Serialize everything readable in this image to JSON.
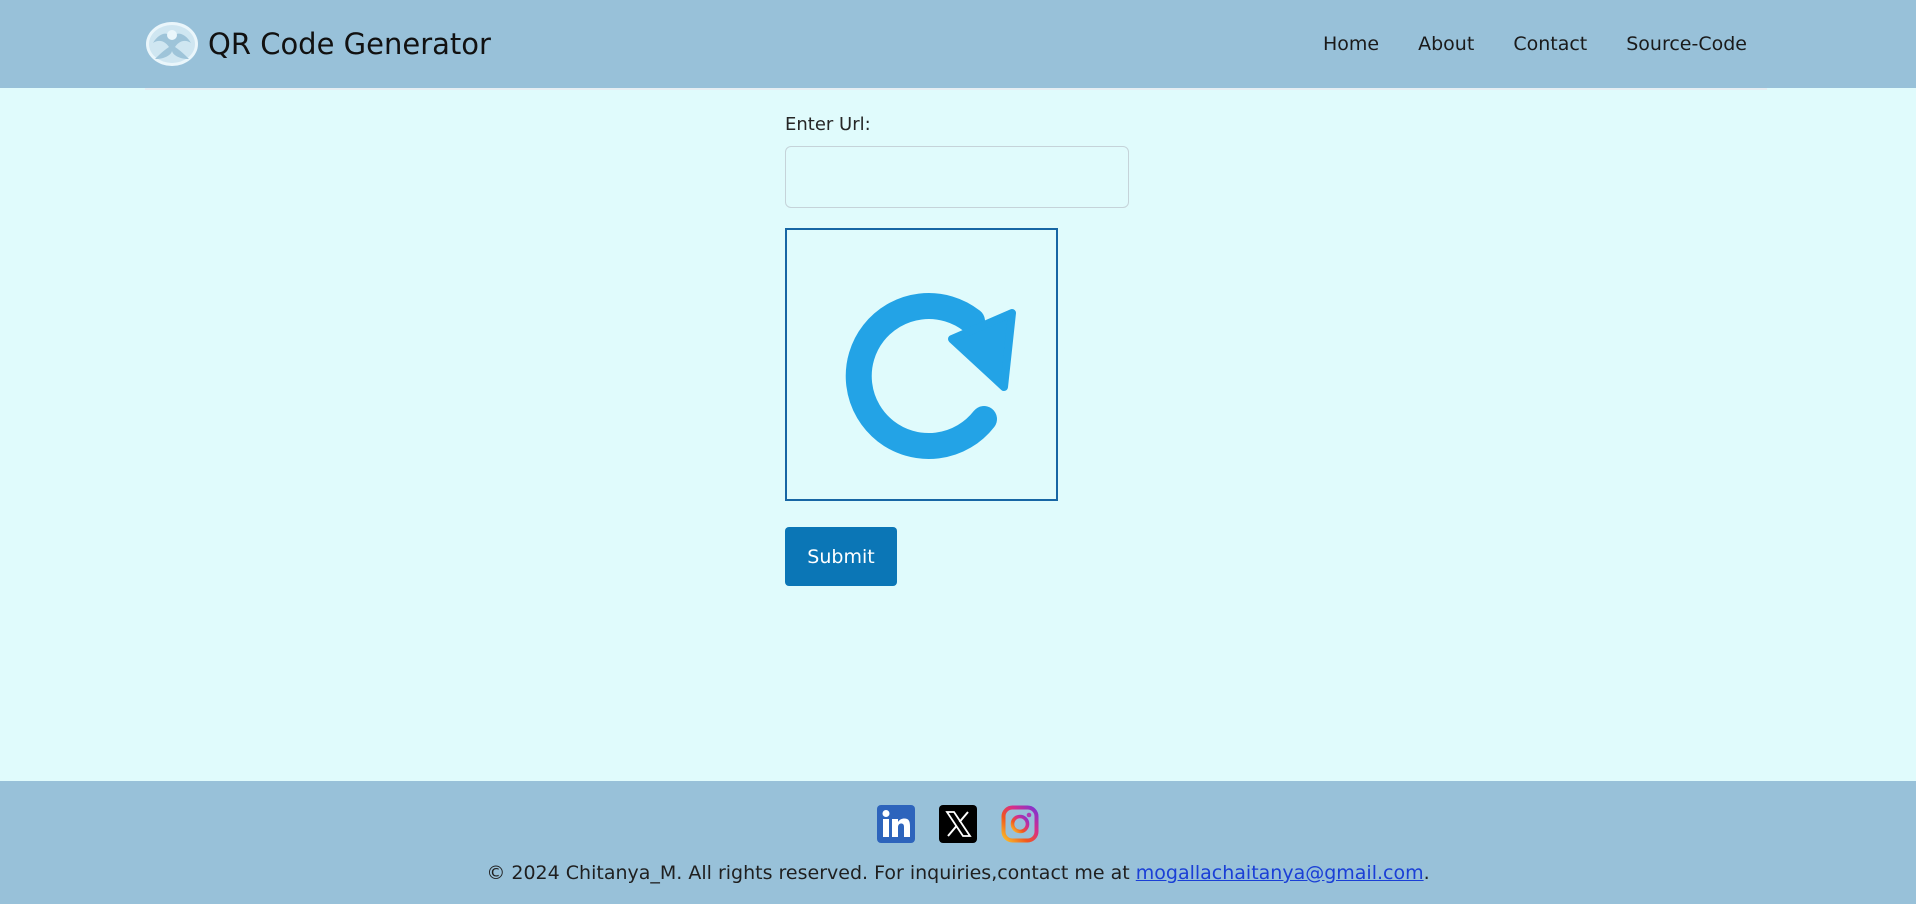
{
  "header": {
    "brand_title": "QR Code Generator",
    "logo_icon": "bird-in-circle-logo",
    "nav": [
      {
        "label": "Home"
      },
      {
        "label": "About"
      },
      {
        "label": "Contact"
      },
      {
        "label": "Source-Code"
      }
    ]
  },
  "form": {
    "url_label": "Enter Url:",
    "url_value": "",
    "url_placeholder": "",
    "preview_icon": "refresh-icon",
    "submit_label": "Submit"
  },
  "footer": {
    "socials": [
      {
        "name": "LinkedIn",
        "icon": "linkedin-icon"
      },
      {
        "name": "X",
        "icon": "x-twitter-icon"
      },
      {
        "name": "Instagram",
        "icon": "instagram-icon"
      }
    ],
    "copyright_text": "© 2024 Chitanya_M. All rights reserved. For inquiries,contact me at ",
    "email": "mogallachaitanya@gmail.com",
    "trailing": "."
  },
  "colors": {
    "header_bg": "#98c1d9",
    "page_bg": "#e0fbfc",
    "accent": "#0b76b6",
    "refresh_icon": "#23a3e6"
  }
}
